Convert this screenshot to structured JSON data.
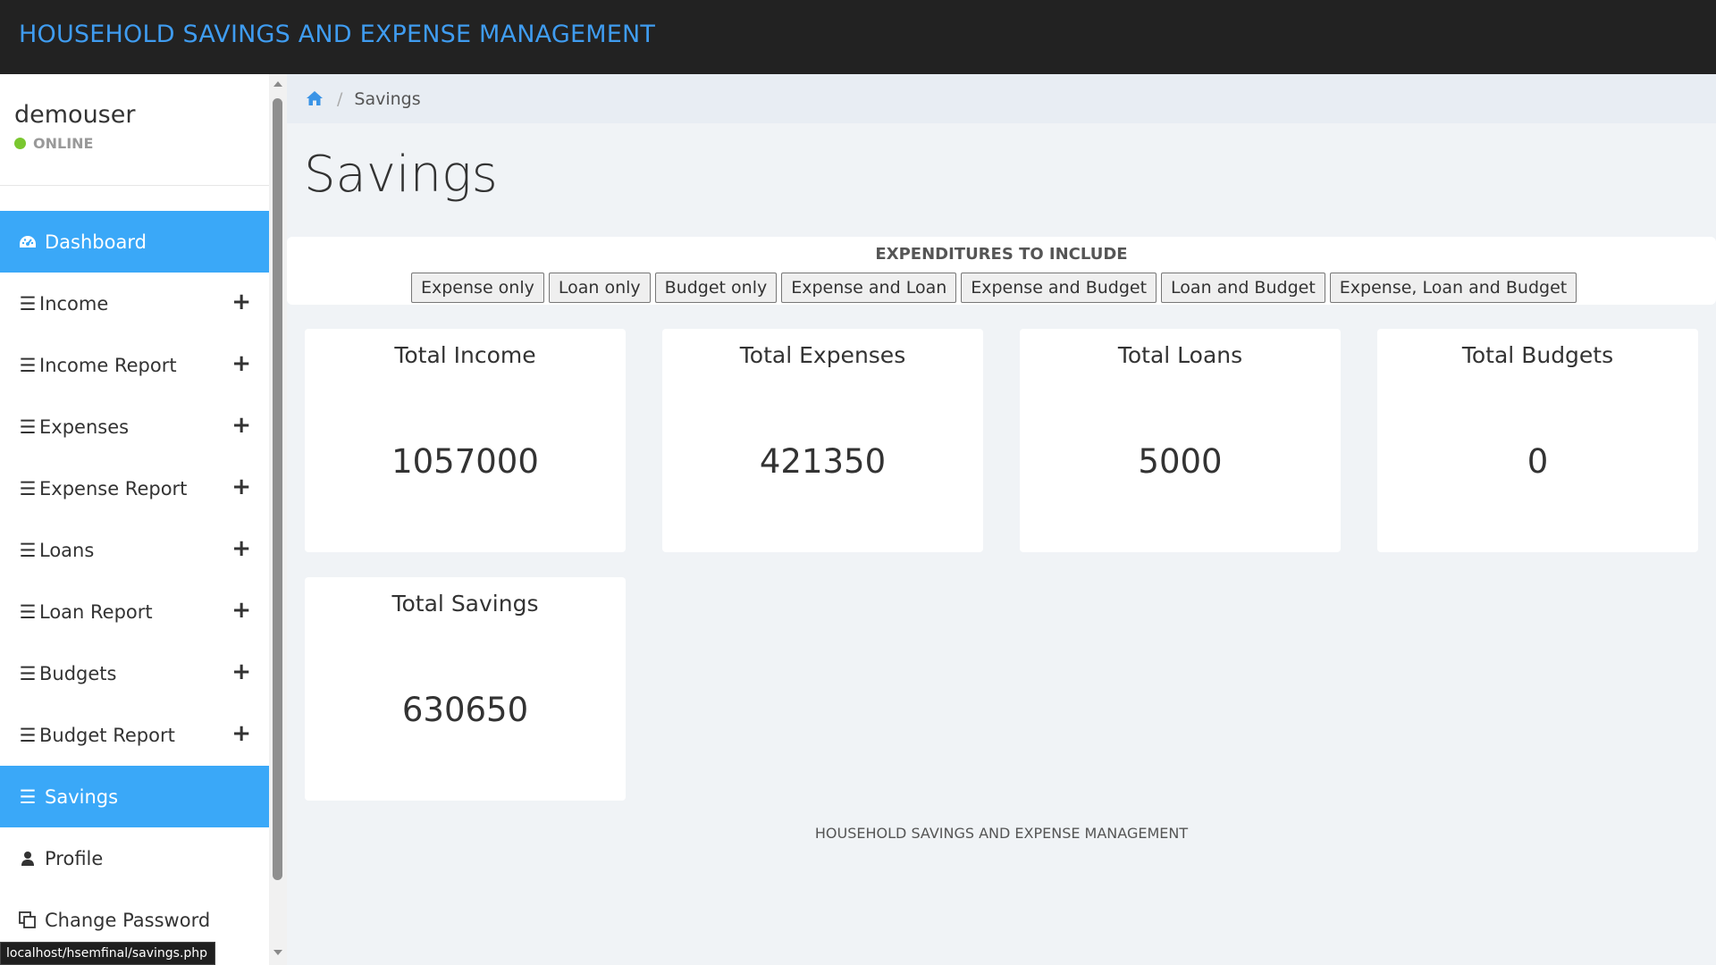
{
  "header": {
    "brand": "HOUSEHOLD SAVINGS AND EXPENSE MANAGEMENT"
  },
  "sidebar": {
    "username": "demouser",
    "status": "ONLINE",
    "status_color": "#7ac72f",
    "accent_color": "#3aa8f8",
    "items": [
      {
        "label": "Dashboard",
        "icon": "dashboard-icon",
        "active": true,
        "expandable": false
      },
      {
        "label": "Income",
        "icon": "bars-icon",
        "active": false,
        "expandable": true
      },
      {
        "label": "Income Report",
        "icon": "bars-icon",
        "active": false,
        "expandable": true
      },
      {
        "label": "Expenses",
        "icon": "bars-icon",
        "active": false,
        "expandable": true
      },
      {
        "label": "Expense Report",
        "icon": "bars-icon",
        "active": false,
        "expandable": true
      },
      {
        "label": "Loans",
        "icon": "bars-icon",
        "active": false,
        "expandable": true
      },
      {
        "label": "Loan Report",
        "icon": "bars-icon",
        "active": false,
        "expandable": true
      },
      {
        "label": "Budgets",
        "icon": "bars-icon",
        "active": false,
        "expandable": true
      },
      {
        "label": "Budget Report",
        "icon": "bars-icon",
        "active": false,
        "expandable": true
      },
      {
        "label": "Savings",
        "icon": "bars-icon",
        "active": true,
        "expandable": false
      },
      {
        "label": "Profile",
        "icon": "user-icon",
        "active": false,
        "expandable": false
      },
      {
        "label": "Change Password",
        "icon": "copy-icon",
        "active": false,
        "expandable": false
      }
    ]
  },
  "breadcrumb": {
    "home_icon": "home-icon",
    "current": "Savings"
  },
  "page": {
    "title": "Savings"
  },
  "filters": {
    "title": "EXPENDITURES TO INCLUDE",
    "buttons": [
      "Expense only",
      "Loan only",
      "Budget only",
      "Expense and Loan",
      "Expense and Budget",
      "Loan and Budget",
      "Expense, Loan and Budget"
    ]
  },
  "cards": [
    {
      "label": "Total Income",
      "value": "1057000"
    },
    {
      "label": "Total Expenses",
      "value": "421350"
    },
    {
      "label": "Total Loans",
      "value": "5000"
    },
    {
      "label": "Total Budgets",
      "value": "0"
    },
    {
      "label": "Total Savings",
      "value": "630650"
    }
  ],
  "footer": {
    "text": "HOUSEHOLD SAVINGS AND EXPENSE MANAGEMENT"
  },
  "status_bar": {
    "url": "localhost/hsemfinal/savings.php"
  }
}
